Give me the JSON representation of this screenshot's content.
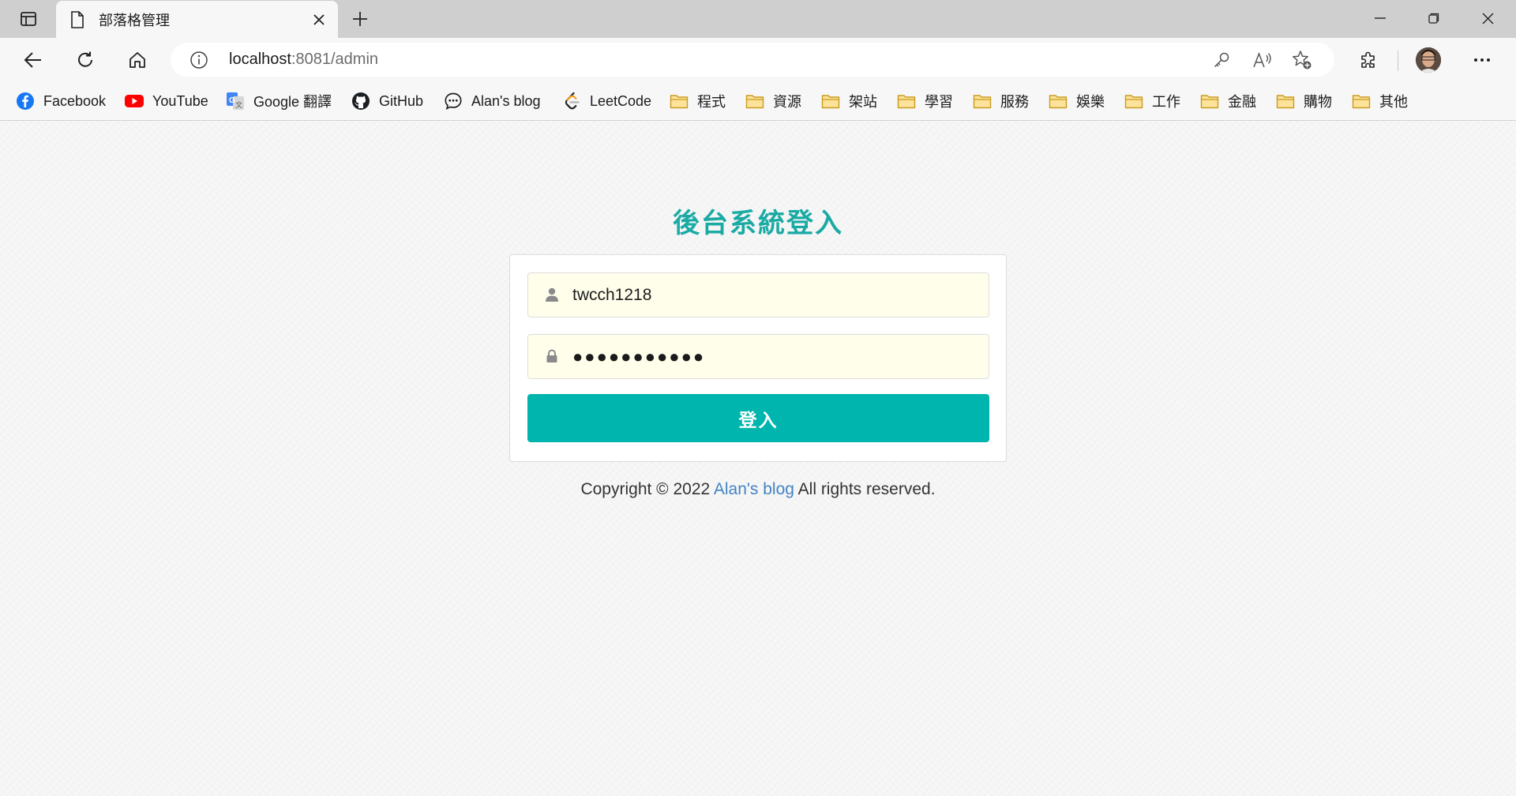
{
  "browser": {
    "tab": {
      "title": "部落格管理"
    },
    "address": {
      "host": "localhost",
      "rest": ":8081/admin"
    },
    "bookmarks": [
      {
        "label": "Facebook",
        "icon": "facebook-icon"
      },
      {
        "label": "YouTube",
        "icon": "youtube-icon"
      },
      {
        "label": "Google 翻譯",
        "icon": "google-translate-icon"
      },
      {
        "label": "GitHub",
        "icon": "github-icon"
      },
      {
        "label": "Alan's blog",
        "icon": "chat-bubble-icon"
      },
      {
        "label": "LeetCode",
        "icon": "leetcode-icon"
      },
      {
        "label": "程式",
        "icon": "folder-icon"
      },
      {
        "label": "資源",
        "icon": "folder-icon"
      },
      {
        "label": "架站",
        "icon": "folder-icon"
      },
      {
        "label": "學習",
        "icon": "folder-icon"
      },
      {
        "label": "服務",
        "icon": "folder-icon"
      },
      {
        "label": "娛樂",
        "icon": "folder-icon"
      },
      {
        "label": "工作",
        "icon": "folder-icon"
      },
      {
        "label": "金融",
        "icon": "folder-icon"
      },
      {
        "label": "購物",
        "icon": "folder-icon"
      },
      {
        "label": "其他",
        "icon": "folder-icon"
      }
    ]
  },
  "login": {
    "title": "後台系統登入",
    "username": "twcch1218",
    "password_masked": "●●●●●●●●●●●",
    "submit_label": "登入"
  },
  "footer": {
    "prefix": "Copyright © 2022",
    "link": "Alan's blog",
    "suffix": "All rights reserved."
  },
  "colors": {
    "accent": "#00b5ad",
    "title": "#1aaaa4",
    "input_bg": "#fffeeb",
    "link": "#4183c4"
  }
}
